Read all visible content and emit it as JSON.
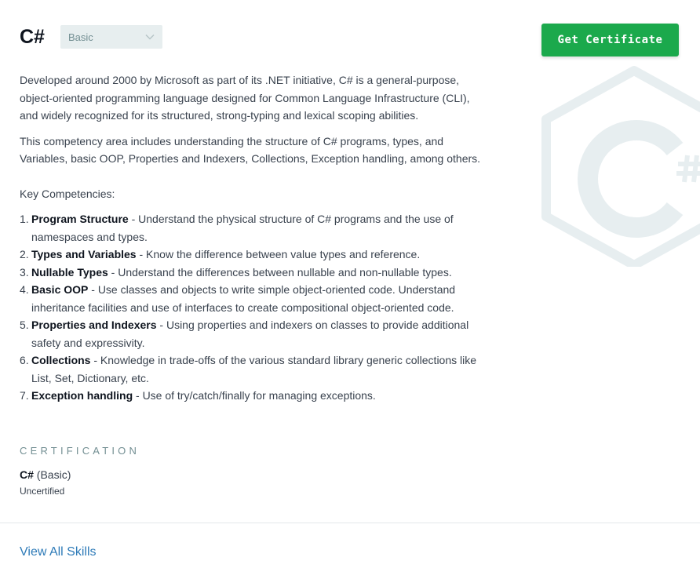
{
  "header": {
    "title": "C#",
    "level_value": "Basic"
  },
  "actions": {
    "get_certificate_label": "Get Certificate"
  },
  "description": {
    "para1": "Developed around 2000 by Microsoft as part of its .NET initiative, C# is a general-purpose, object-oriented programming language designed for Common Language Infrastructure (CLI), and widely recognized for its structured, strong-typing and lexical scoping abilities.",
    "para2": "This competency area includes understanding the structure of C# programs, types, and Variables, basic OOP, Properties and Indexers, Collections, Exception handling, among others."
  },
  "competencies": {
    "heading": "Key Competencies:",
    "items": [
      {
        "num": "1.",
        "name": "Program Structure",
        "desc": " - Understand the physical structure of C# programs and the use of namespaces and types."
      },
      {
        "num": "2.",
        "name": "Types and Variables",
        "desc": " - Know the difference between value types and reference."
      },
      {
        "num": "3.",
        "name": "Nullable Types",
        "desc": " - Understand the differences between nullable and non-nullable types."
      },
      {
        "num": "4.",
        "name": "Basic OOP",
        "desc": " - Use classes and objects to write simple object-oriented code. Understand inheritance facilities and use of interfaces to create compositional object-oriented code."
      },
      {
        "num": "5.",
        "name": "Properties and Indexers",
        "desc": " - Using properties and indexers on classes to provide additional safety and expressivity."
      },
      {
        "num": "6.",
        "name": "Collections",
        "desc": " - Knowledge in trade-offs of the various standard library generic collections like List, Set, Dictionary, etc."
      },
      {
        "num": "7.",
        "name": "Exception handling",
        "desc": " - Use of try/catch/finally for managing exceptions."
      }
    ]
  },
  "certification": {
    "section_label": "CERTIFICATION",
    "skill_name": "C#",
    "skill_level": " (Basic)",
    "status": "Uncertified"
  },
  "footer": {
    "view_all_label": "View All Skills"
  },
  "colors": {
    "accent_green": "#1ba94c",
    "link_blue": "#2e7bb8",
    "muted_text": "#738f93",
    "watermark": "#e7eef0"
  },
  "icons": {
    "watermark": "csharp-logo-icon",
    "dropdown": "chevron-down-icon"
  }
}
